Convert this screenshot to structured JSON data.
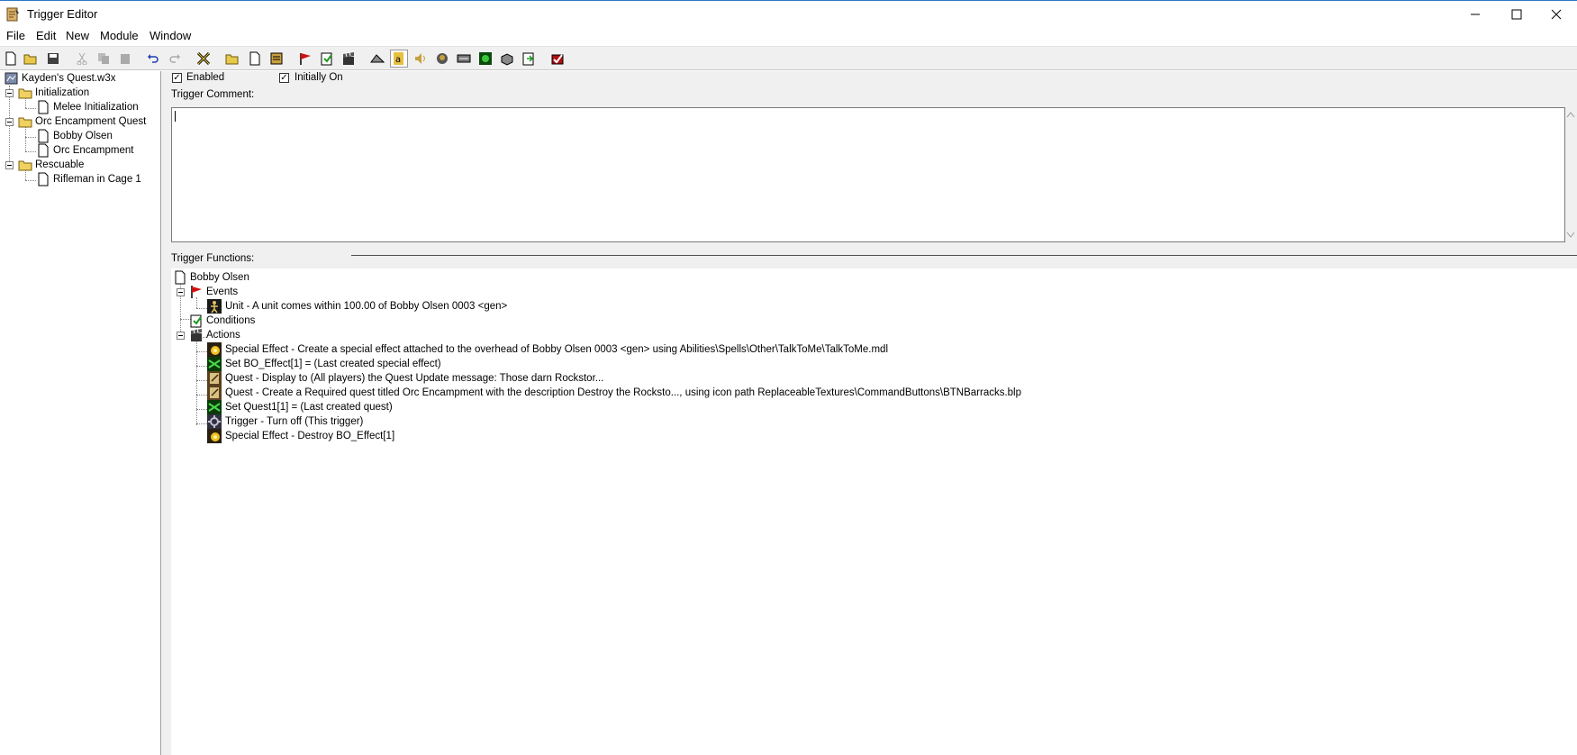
{
  "window": {
    "title": "Trigger Editor"
  },
  "menu": [
    "File",
    "Edit",
    "New",
    "Module",
    "Window"
  ],
  "tree": {
    "root": "Kayden's Quest.w3x",
    "folders": [
      {
        "label": "Initialization",
        "items": [
          "Melee Initialization"
        ]
      },
      {
        "label": "Orc Encampment Quest",
        "items": [
          "Bobby Olsen",
          "Orc Encampment"
        ]
      },
      {
        "label": "Rescuable",
        "items": [
          "Rifleman in Cage 1"
        ]
      }
    ]
  },
  "trigger": {
    "enabled_label": "Enabled",
    "enabled": true,
    "initially_on_label": "Initially On",
    "initially_on": true,
    "comment_label": "Trigger Comment:",
    "comment_value": "",
    "functions_label": "Trigger Functions:"
  },
  "functions": {
    "name": "Bobby Olsen",
    "events_label": "Events",
    "events": [
      "Unit - A unit comes within 100.00 of Bobby Olsen 0003 <gen>"
    ],
    "conditions_label": "Conditions",
    "actions_label": "Actions",
    "actions": [
      {
        "icon": "special-effect-icon",
        "text": "Special Effect - Create a special effect attached to the overhead of Bobby Olsen 0003 <gen> using Abilities\\Spells\\Other\\TalkToMe\\TalkToMe.mdl"
      },
      {
        "icon": "set-variable-icon",
        "text": "Set BO_Effect[1] = (Last created special effect)"
      },
      {
        "icon": "quest-icon",
        "text": "Quest - Display to (All players) the Quest Update message: Those darn Rockstor..."
      },
      {
        "icon": "quest-icon",
        "text": "Quest - Create a Required quest titled Orc Encampment with the description Destroy the Rocksto..., using icon path ReplaceableTextures\\CommandButtons\\BTNBarracks.blp"
      },
      {
        "icon": "set-variable-icon",
        "text": "Set Quest1[1] = (Last created quest)"
      },
      {
        "icon": "trigger-icon",
        "text": "Trigger - Turn off (This trigger)"
      },
      {
        "icon": "special-effect-icon",
        "text": "Special Effect - Destroy BO_Effect[1]"
      }
    ]
  }
}
